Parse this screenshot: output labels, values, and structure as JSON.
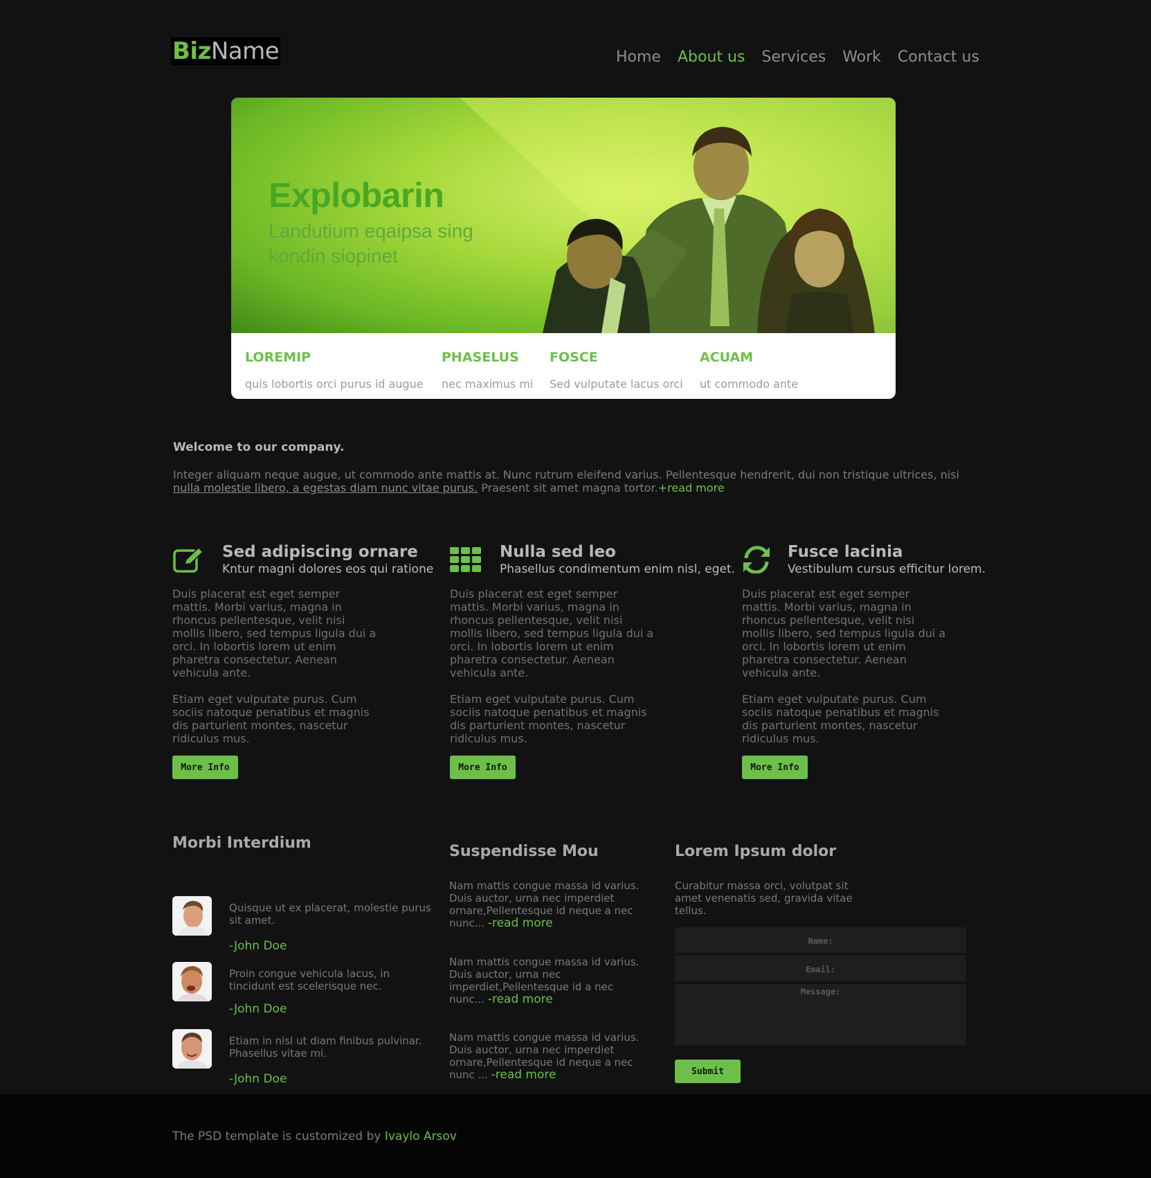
{
  "logo": {
    "part1": "Biz",
    "part2": "Name"
  },
  "nav": [
    {
      "label": "Home"
    },
    {
      "label": "About us",
      "active": true
    },
    {
      "label": "Services"
    },
    {
      "label": "Work"
    },
    {
      "label": "Contact us"
    }
  ],
  "hero": {
    "title": "Explobarin",
    "subtitle": "Landutium eqaipsa sing kondin siopinet",
    "features": [
      {
        "title": "LOREMIP",
        "text": "quis lobortis orci purus id augue"
      },
      {
        "title": "PHASELUS",
        "text": "nec maximus mi"
      },
      {
        "title": "FOSCE",
        "text": "Sed vulputate lacus orci"
      },
      {
        "title": "ACUAM",
        "text": "ut commodo ante"
      }
    ]
  },
  "welcome": {
    "heading": "Welcome to our company.",
    "text1": "Integer aliquam neque augue, ut commodo ante mattis at. Nunc rutrum eleifend varius. Pellentesque hendrerit, dui non tristique ultrices, nisi ",
    "link": "nulla molestie libero, a egestas diam nunc vitae purus.",
    "text2": " Praesent sit amet magna tortor.",
    "read_more": "+read more"
  },
  "columns": [
    {
      "icon": "edit-icon",
      "title": "Sed adipiscing ornare",
      "subtitle": "Kntur magni dolores eos qui ratione",
      "p1": "Duis placerat est eget semper mattis. Morbi varius, magna in rhoncus pellentesque, velit nisi mollis libero, sed tempus ligula dui a orci. In lobortis lorem ut enim pharetra consectetur. Aenean vehicula ante.",
      "p2": "Etiam eget vulputate purus. Cum sociis natoque penatibus et magnis dis parturient montes, nascetur ridiculus mus.",
      "button": "More Info"
    },
    {
      "icon": "grid-icon",
      "title": "Nulla sed leo",
      "subtitle": "Phasellus condimentum enim nisl, eget.",
      "p1": "Duis placerat est eget semper mattis. Morbi varius, magna in rhoncus pellentesque, velit nisi mollis libero, sed tempus ligula dui a orci. In lobortis lorem ut enim pharetra consectetur. Aenean vehicula ante.",
      "p2": "Etiam eget vulputate purus. Cum sociis natoque penatibus et magnis dis parturient montes, nascetur ridiculus mus.",
      "button": "More Info"
    },
    {
      "icon": "refresh-icon",
      "title": "Fusce lacinia",
      "subtitle": "Vestibulum cursus efficitur lorem.",
      "p1": "Duis placerat est eget semper mattis. Morbi varius, magna in rhoncus pellentesque, velit nisi mollis libero, sed tempus ligula dui a orci. In lobortis lorem ut enim pharetra consectetur. Aenean vehicula ante.",
      "p2": "Etiam eget vulputate purus. Cum sociis natoque penatibus et magnis dis parturient montes, nascetur ridiculus mus.",
      "button": "More Info"
    }
  ],
  "testimonials": {
    "heading": "Morbi Interdium",
    "items": [
      {
        "text": "Quisque ut ex placerat, molestie purus sit amet.",
        "author": "-John Doe"
      },
      {
        "text": "Proin congue vehicula lacus, in tincidunt est scelerisque nec.",
        "author": "-John Doe"
      },
      {
        "text": "Etiam in nisl ut diam finibus pulvinar. Phasellus vitae mi.",
        "author": "-John Doe"
      }
    ]
  },
  "news": {
    "heading": "Suspendisse Mou",
    "items": [
      {
        "text": "Nam mattis congue massa id varius. Duis auctor, urna nec imperdiet ornare,Pellentesque id neque a nec nunc... ",
        "read_more": "-read more"
      },
      {
        "text": "Nam mattis congue massa id varius. Duis auctor, urna nec imperdiet,Pellentesque id a nec nunc... ",
        "read_more": "-read more"
      },
      {
        "text": "Nam mattis congue massa id varius. Duis auctor, urna nec imperdiet ornare,Pellentesque id neque a nec nunc ... ",
        "read_more": "-read more"
      }
    ]
  },
  "contact": {
    "heading": "Lorem Ipsum dolor",
    "text": "Curabitur massa orci, volutpat sit amet venenatis sed, gravida vitae tellus.",
    "name_placeholder": "Name:",
    "email_placeholder": "Email:",
    "message_placeholder": "Message:",
    "submit": "Submit"
  },
  "footer": {
    "text": "The PSD template is customized by ",
    "author": "Ivaylo Arsov"
  },
  "colors": {
    "accent": "#6cc04a",
    "background": "#121212",
    "footer": "#050505"
  }
}
